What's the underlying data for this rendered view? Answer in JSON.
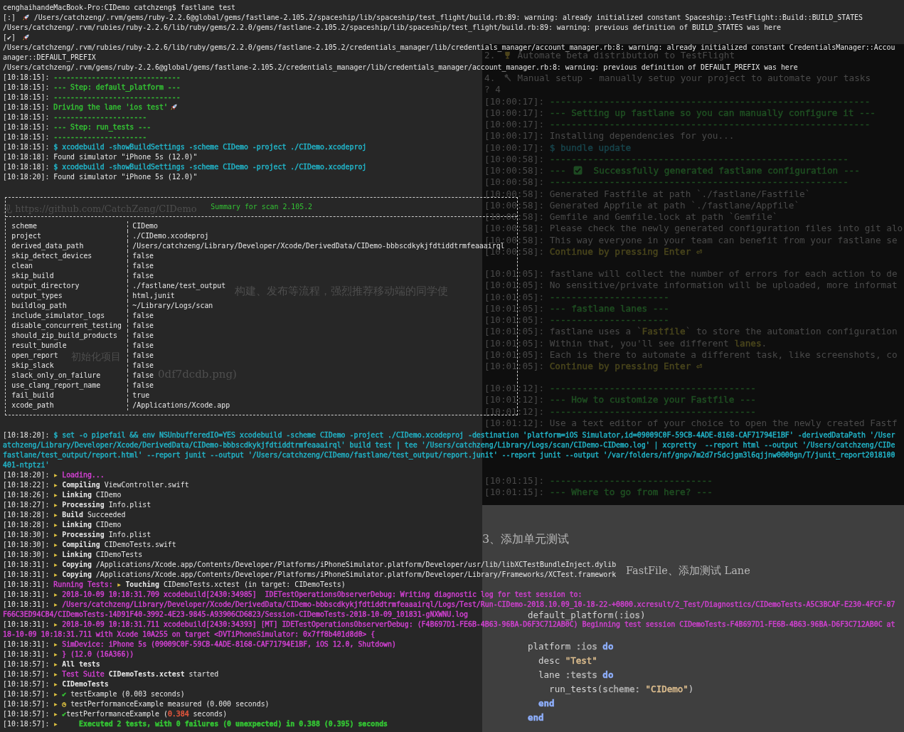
{
  "terminal": {
    "lines_top": [
      [
        {
          "text": "cenghaihandeMacBook-Pro:CIDemo catchzeng$ fastlane test"
        }
      ],
      [
        {
          "text": "[:] "
        },
        {
          "kind": "rocket"
        },
        {
          "text": " /Users/catchzeng/.rvm/gems/ruby-2.2.6@global/gems/fastlane-2.105.2/spaceship/lib/spaceship/test_flight/build.rb:89: warning: already initialized constant Spaceship::TestFlight::Build::BUILD_STATES"
        }
      ],
      [
        {
          "text": "/Users/catchzeng/.rvm/rubies/ruby-2.2.6/lib/ruby/gems/2.2.0/gems/fastlane-2.105.2/spaceship/lib/spaceship/test_flight/build.rb:89: warning: previous definition of BUILD_STATES was here"
        }
      ],
      [
        {
          "text": "[✔] "
        },
        {
          "kind": "rocket"
        }
      ],
      [
        {
          "text": "/Users/catchzeng/.rvm/rubies/ruby-2.2.6/lib/ruby/gems/2.2.0/gems/fastlane-2.105.2/credentials_manager/lib/credentials_manager/account_manager.rb:8: warning: already initialized constant CredentialsManager::Accou"
        }
      ],
      [
        {
          "text": "anager::DEFAULT_PREFIX"
        }
      ],
      [
        {
          "text": "/Users/catchzeng/.rvm/gems/ruby-2.2.6@global/gems/fastlane-2.105.2/credentials_manager/lib/credentials_manager/account_manager.rb:8: warning: previous definition of DEFAULT_PREFIX was here"
        }
      ],
      [
        {
          "text": "[10:18:15]: "
        },
        {
          "text": "------------------------------",
          "color": "#34c234"
        }
      ],
      [
        {
          "text": "[10:18:15]: "
        },
        {
          "text": "--- Step: default_platform ---",
          "color": "#34c234"
        }
      ],
      [
        {
          "text": "[10:18:15]: "
        },
        {
          "text": "------------------------------",
          "color": "#34c234"
        }
      ],
      [
        {
          "text": "[10:18:15]: "
        },
        {
          "text": "Driving the lane 'ios test'",
          "color": "#34c234"
        },
        {
          "kind": "rocket"
        }
      ],
      [
        {
          "text": "[10:18:15]: "
        },
        {
          "text": "----------------------",
          "color": "#34c234"
        }
      ],
      [
        {
          "text": "[10:18:15]: "
        },
        {
          "text": "--- Step: run_tests ---",
          "color": "#34c234"
        }
      ],
      [
        {
          "text": "[10:18:15]: "
        },
        {
          "text": "----------------------",
          "color": "#34c234"
        }
      ],
      [
        {
          "text": "[10:18:15]: "
        },
        {
          "text": "$ xcodebuild -showBuildSettings -scheme CIDemo -project ./CIDemo.xcodeproj",
          "color": "#22b4c8"
        }
      ],
      [
        {
          "text": "[10:18:18]: Found simulator \"iPhone 5s (12.0)\""
        }
      ],
      [
        {
          "text": "[10:18:18]: "
        },
        {
          "text": "$ xcodebuild -showBuildSettings -scheme CIDemo -project ./CIDemo.xcodeproj",
          "color": "#22b4c8"
        }
      ],
      [
        {
          "text": "[10:18:20]: Found simulator \"iPhone 5s (12.0)\""
        }
      ]
    ],
    "scan_summary": {
      "title": "Summary for scan 2.105.2",
      "rows": [
        {
          "key": "scheme",
          "value": "CIDemo"
        },
        {
          "key": "project",
          "value": "./CIDemo.xcodeproj"
        },
        {
          "key": "derived_data_path",
          "value": "/Users/catchzeng/Library/Developer/Xcode/DerivedData/CIDemo-bbbscdkykjfdtiddtrmfeaaairql"
        },
        {
          "key": "skip_detect_devices",
          "value": "false"
        },
        {
          "key": "clean",
          "value": "false"
        },
        {
          "key": "skip_build",
          "value": "false"
        },
        {
          "key": "output_directory",
          "value": "./fastlane/test_output"
        },
        {
          "key": "output_types",
          "value": "html,junit"
        },
        {
          "key": "buildlog_path",
          "value": "~/Library/Logs/scan"
        },
        {
          "key": "include_simulator_logs",
          "value": "false"
        },
        {
          "key": "disable_concurrent_testing",
          "value": "false"
        },
        {
          "key": "should_zip_build_products",
          "value": "false"
        },
        {
          "key": "result_bundle",
          "value": "false"
        },
        {
          "key": "open_report",
          "value": "false"
        },
        {
          "key": "skip_slack",
          "value": "false"
        },
        {
          "key": "slack_only_on_failure",
          "value": "false"
        },
        {
          "key": "use_clang_report_name",
          "value": "false"
        },
        {
          "key": "fail_build",
          "value": "true"
        },
        {
          "key": "xcode_path",
          "value": "/Applications/Xcode.app"
        }
      ]
    },
    "lines_bottom": [
      [
        {
          "text": "[10:18:20]: "
        },
        {
          "text": "$ set -o pipefail && env NSUnbufferedIO=YES xcodebuild -scheme CIDemo -project ./CIDemo.xcodeproj -destination 'platform=iOS Simulator,id=09009C0F-59CB-4ADE-8168-CAF71794E1BF' -derivedDataPath '/User",
          "color": "#22b4c8"
        }
      ],
      [
        {
          "text": "atchzeng/Library/Developer/Xcode/DerivedData/CIDemo-bbbscdkykjfdtiddtrmfeaaairql' build test | tee '/Users/catchzeng/Library/Logs/scan/CIDemo-CIDemo.log' | xcpretty  --report html --output '/Users/catchzeng/CIDe",
          "color": "#22b4c8"
        }
      ],
      [
        {
          "text": "fastlane/test_output/report.html' --report junit --output '/Users/catchzeng/CIDemo/fastlane/test_output/report.junit' --report junit --output '/var/folders/nf/gnpv7m2d7r5dcjgm3l6qjjnw0000gn/T/junit_report2018100",
          "color": "#22b4c8"
        }
      ],
      [
        {
          "text": "401-ntptzi'",
          "color": "#22b4c8"
        }
      ],
      [
        {
          "text": "[10:18:20]: "
        },
        {
          "text": "▸ ",
          "color": "#e0c341"
        },
        {
          "text": "Loading...",
          "color": "#d040d0"
        }
      ],
      [
        {
          "text": "[10:18:22]: "
        },
        {
          "text": "▸ ",
          "color": "#e0c341"
        },
        {
          "text": "Compiling",
          "bold": true
        },
        {
          "text": " ViewController.swift"
        }
      ],
      [
        {
          "text": "[10:18:26]: "
        },
        {
          "text": "▸ ",
          "color": "#e0c341"
        },
        {
          "text": "Linking",
          "bold": true
        },
        {
          "text": " CIDemo"
        }
      ],
      [
        {
          "text": "[10:18:27]: "
        },
        {
          "text": "▸ ",
          "color": "#e0c341"
        },
        {
          "text": "Processing",
          "bold": true
        },
        {
          "text": " Info.plist"
        }
      ],
      [
        {
          "text": "[10:18:28]: "
        },
        {
          "text": "▸ ",
          "color": "#e0c341"
        },
        {
          "text": "Build",
          "bold": true
        },
        {
          "text": " Succeeded"
        }
      ],
      [
        {
          "text": "[10:18:28]: "
        },
        {
          "text": "▸ ",
          "color": "#e0c341"
        },
        {
          "text": "Linking",
          "bold": true
        },
        {
          "text": " CIDemo"
        }
      ],
      [
        {
          "text": "[10:18:30]: "
        },
        {
          "text": "▸ ",
          "color": "#e0c341"
        },
        {
          "text": "Processing",
          "bold": true
        },
        {
          "text": " Info.plist"
        }
      ],
      [
        {
          "text": "[10:18:30]: "
        },
        {
          "text": "▸ ",
          "color": "#e0c341"
        },
        {
          "text": "Compiling",
          "bold": true
        },
        {
          "text": " CIDemoTests.swift"
        }
      ],
      [
        {
          "text": "[10:18:30]: "
        },
        {
          "text": "▸ ",
          "color": "#e0c341"
        },
        {
          "text": "Linking",
          "bold": true
        },
        {
          "text": " CIDemoTests"
        }
      ],
      [
        {
          "text": "[10:18:31]: "
        },
        {
          "text": "▸ ",
          "color": "#e0c341"
        },
        {
          "text": "Copying",
          "bold": true
        },
        {
          "text": " /Applications/Xcode.app/Contents/Developer/Platforms/iPhoneSimulator.platform/Developer/usr/lib/libXCTestBundleInject.dylib"
        }
      ],
      [
        {
          "text": "[10:18:31]: "
        },
        {
          "text": "▸ ",
          "color": "#e0c341"
        },
        {
          "text": "Copying",
          "bold": true
        },
        {
          "text": " /Applications/Xcode.app/Contents/Developer/Platforms/iPhoneSimulator.platform/Developer/Library/Frameworks/XCTest.framework"
        }
      ],
      [
        {
          "text": "[10:18:31]: "
        },
        {
          "text": "Running Tests: ",
          "color": "#d040d0"
        },
        {
          "text": "▸ ",
          "color": "#e0c341"
        },
        {
          "text": "Touching",
          "bold": true
        },
        {
          "text": " CIDemoTests.xctest (in target: CIDemoTests)"
        }
      ],
      [
        {
          "text": "[10:18:31]: "
        },
        {
          "text": "▸ ",
          "color": "#e0c341"
        },
        {
          "text": "2018-10-09 10:18:31.709 xcodebuild[2430:34985]  IDETestOperationsObserverDebug: Writing diagnostic log for test session to:",
          "color": "#d040d0"
        }
      ],
      [
        {
          "text": "[10:18:31]: "
        },
        {
          "text": "▸ ",
          "color": "#e0c341"
        },
        {
          "text": "/Users/catchzeng/Library/Developer/Xcode/DerivedData/CIDemo-bbbscdkykjfdtiddtrmfeaaairql/Logs/Test/Run-CIDemo-2018.10.09_10-18-22-+0800.xcresult/2_Test/Diagnostics/CIDemoTests-A5C3BCAF-E230-4FCF-87",
          "color": "#d040d0"
        }
      ],
      [
        {
          "text": "F66C3ED94CB4/CIDemoTests-14D91F40-3992-4E23-9845-A93906CD6823/Session-CIDemoTests-2018-10-09_101831-gNXWNU.log",
          "color": "#d040d0"
        }
      ],
      [
        {
          "text": "[10:18:31]: "
        },
        {
          "text": "▸ ",
          "color": "#e0c341"
        },
        {
          "text": "2018-10-09 10:18:31.711 xcodebuild[2430:34393] [MT] IDETestOperationsObserverDebug: (F4B697D1-FE6B-4B63-96BA-D6F3C712AB0C) Beginning test session CIDemoTests-F4B697D1-FE6B-4B63-96BA-D6F3C712AB0C at",
          "color": "#d040d0"
        }
      ],
      [
        {
          "text": "18-10-09 10:18:31.711 with Xcode 10A255 on target <DVTiPhoneSimulator: 0x7ff8b401d8d0> {",
          "color": "#d040d0"
        }
      ],
      [
        {
          "text": "[10:18:31]: "
        },
        {
          "text": "▸ ",
          "color": "#e0c341"
        },
        {
          "text": "SimDevice: iPhone 5s (09009C0F-59CB-4ADE-8168-CAF71794E1BF, iOS 12.0, Shutdown)",
          "color": "#d040d0"
        }
      ],
      [
        {
          "text": "[10:18:31]: "
        },
        {
          "text": "▸ ",
          "color": "#e0c341"
        },
        {
          "text": "} (12.0 (16A366))",
          "color": "#d040d0"
        }
      ],
      [
        {
          "text": "[10:18:57]: "
        },
        {
          "text": "▸ ",
          "color": "#e0c341"
        },
        {
          "text": "All tests",
          "bold": true
        }
      ],
      [
        {
          "text": "[10:18:57]: "
        },
        {
          "text": "▸ ",
          "color": "#e0c341"
        },
        {
          "text": "Test Suite ",
          "color": "#d040d0"
        },
        {
          "text": "CIDemoTests.xctest",
          "bold": true
        },
        {
          "text": " started"
        }
      ],
      [
        {
          "text": "[10:18:57]: "
        },
        {
          "text": "▸ ",
          "color": "#e0c341"
        },
        {
          "text": "CIDemoTests",
          "bold": true
        }
      ],
      [
        {
          "text": "[10:18:57]: "
        },
        {
          "text": "▸ ",
          "color": "#e0c341"
        },
        {
          "text": "✔",
          "color": "#34c234"
        },
        {
          "text": " testExample (0.003 seconds)"
        }
      ],
      [
        {
          "text": "[10:18:57]: "
        },
        {
          "text": "▸ ",
          "color": "#e0c341"
        },
        {
          "text": "◷",
          "color": "#e0c341"
        },
        {
          "text": " testPerformanceExample measured (0.000 seconds)"
        }
      ],
      [
        {
          "text": "[10:18:57]: "
        },
        {
          "text": "▸ ",
          "color": "#e0c341"
        },
        {
          "text": "✔",
          "color": "#34c234"
        },
        {
          "text": "testPerformanceExample ("
        },
        {
          "text": "0.384",
          "color": "#e5563d"
        },
        {
          "text": " seconds)"
        }
      ],
      [
        {
          "text": "[10:18:57]: "
        },
        {
          "text": "▸ ",
          "color": "#e0c341"
        },
        {
          "text": "    Executed 2 tests, with 0 failures (0 unexpected) in 0.388 (0.395) seconds",
          "color": "#34c234",
          "bold": true
        }
      ]
    ]
  },
  "background_terminal": {
    "blocks": [
      [
        [
          {
            "text": "2. "
          },
          {
            "kind": "trophy"
          },
          {
            "text": " Automate beta distribution to TestFlight"
          }
        ]
      ],
      [
        [
          {
            "text": "4. "
          },
          {
            "kind": "hammer"
          },
          {
            "text": " Manual setup - manually setup your project to automate your tasks"
          }
        ],
        [
          {
            "text": "? 4"
          }
        ],
        [
          {
            "text": "[10:00:17]: "
          },
          {
            "text": "-----------------------------------------------------------",
            "color": "#1f4f22"
          }
        ],
        [
          {
            "text": "[10:00:17]: "
          },
          {
            "text": "--- Setting up fastlane so you can manually configure it ---",
            "color": "#1f4f22"
          }
        ],
        [
          {
            "text": "[10:00:17]: "
          },
          {
            "text": "-----------------------------------------------------------",
            "color": "#1f4f22"
          }
        ],
        [
          {
            "text": "[10:00:17]: Installing dependencies for you..."
          }
        ],
        [
          {
            "text": "[10:00:17]: "
          },
          {
            "text": "$ bundle update",
            "color": "#17434a"
          }
        ],
        [
          {
            "text": "[10:00:58]: "
          },
          {
            "text": "-------------------------------------------------------",
            "color": "#1f4f22"
          }
        ],
        [
          {
            "text": "[10:00:58]: "
          },
          {
            "text": "--- ",
            "color": "#1f4f22"
          },
          {
            "kind": "checkbox"
          },
          {
            "text": "  Successfully generated fastlane configuration ---",
            "color": "#1f4f22"
          }
        ],
        [
          {
            "text": "[10:00:58]: "
          },
          {
            "text": "-------------------------------------------------------",
            "color": "#1f4f22"
          }
        ],
        [
          {
            "text": "[10:00:58]: Generated Fastfile at path `./fastlane/Fastfile`"
          }
        ],
        [
          {
            "text": "[10:00:58]: Generated Appfile at path `./fastlane/Appfile`"
          }
        ],
        [
          {
            "text": "[10:00:58]: Gemfile and Gemfile.lock at path `Gemfile`"
          }
        ],
        [
          {
            "text": "[10:00:58]: Please check the newly generated configuration files into git alo"
          }
        ],
        [
          {
            "text": "[10:00:58]: This way everyone in your team can benefit from your fastlane se"
          }
        ],
        [
          {
            "text": "[10:00:58]: "
          },
          {
            "text": "Continue by pressing Enter ⏎",
            "color": "#4a461c"
          }
        ]
      ],
      [
        [
          {
            "text": "[10:01:05]: fastlane will collect the number of errors for each action to de"
          }
        ],
        [
          {
            "text": "[10:01:05]: No sensitive/private information will be uploaded, more informat"
          }
        ],
        [
          {
            "text": "[10:01:05]: "
          },
          {
            "text": "----------------------",
            "color": "#1f4f22"
          }
        ],
        [
          {
            "text": "[10:01:05]: "
          },
          {
            "text": "--- fastlane lanes ---",
            "color": "#1f4f22"
          }
        ],
        [
          {
            "text": "[10:01:05]: "
          },
          {
            "text": "----------------------",
            "color": "#1f4f22"
          }
        ],
        [
          {
            "text": "[10:01:05]: fastlane uses a `"
          },
          {
            "text": "Fastfile",
            "color": "#4a461c"
          },
          {
            "text": "` to store the automation configuration"
          }
        ],
        [
          {
            "text": "[10:01:05]: Within that, you'll see different "
          },
          {
            "text": "lanes",
            "color": "#4a461c"
          },
          {
            "text": "."
          }
        ],
        [
          {
            "text": "[10:01:05]: Each is there to automate a different task, like screenshots, co"
          }
        ],
        [
          {
            "text": "[10:01:05]: "
          },
          {
            "text": "Continue by pressing Enter ⏎",
            "color": "#4a461c"
          }
        ]
      ],
      [
        [
          {
            "text": "[10:01:12]: "
          },
          {
            "text": "--------------------------------------",
            "color": "#1f4f22"
          }
        ],
        [
          {
            "text": "[10:01:12]: "
          },
          {
            "text": "--- How to customize your Fastfile ---",
            "color": "#1f4f22"
          }
        ],
        [
          {
            "text": "[10:01:12]: "
          },
          {
            "text": "--------------------------------------",
            "color": "#1f4f22"
          }
        ],
        [
          {
            "text": "[10:01:12]: Use a text editor of your choice to open the newly created Fastf"
          }
        ]
      ],
      [
        [
          {
            "text": "[10:01:15]: "
          },
          {
            "text": "------------------------------",
            "color": "#1f4f22"
          }
        ],
        [
          {
            "text": "[10:01:15]: "
          },
          {
            "text": "--- Where to go from here? ---",
            "color": "#1f4f22"
          }
        ]
      ]
    ]
  },
  "background_page": {
    "fragments": [
      "见 https://github.com/CatchZeng/CIDemo",
      "构建、发布等流程，强烈推荐移动端的同学使",
      "初始化项目",
      "0df7dcdb.png)"
    ],
    "heading": "3、添加单元测试",
    "step_text": "FastFile、添加测试 Lane",
    "code_lines": [
      [
        {
          "text": "default_platform("
        },
        {
          "text": ":ios",
          "color": "#b0b0b0"
        },
        {
          "text": ")"
        }
      ],
      [
        {
          "text": "platform "
        },
        {
          "text": ":ios",
          "color": "#b0b0b0"
        },
        {
          "text": " do",
          "color": "#8fb0ff",
          "bold": true
        }
      ],
      [
        {
          "text": "  desc "
        },
        {
          "text": "\"Test\"",
          "color": "#e0c090"
        }
      ],
      [
        {
          "text": "  lane "
        },
        {
          "text": ":tests",
          "color": "#b0b0b0"
        },
        {
          "text": " do",
          "color": "#8fb0ff",
          "bold": true
        }
      ],
      [
        {
          "text": "    run_tests("
        },
        {
          "text": "scheme: ",
          "color": "#b0b0b0"
        },
        {
          "text": "\"CIDemo\"",
          "color": "#e0c090"
        },
        {
          "text": ")"
        }
      ],
      [
        {
          "text": "  end",
          "color": "#8fb0ff",
          "bold": true
        }
      ],
      [
        {
          "text": "end",
          "color": "#8fb0ff",
          "bold": true
        }
      ]
    ]
  }
}
